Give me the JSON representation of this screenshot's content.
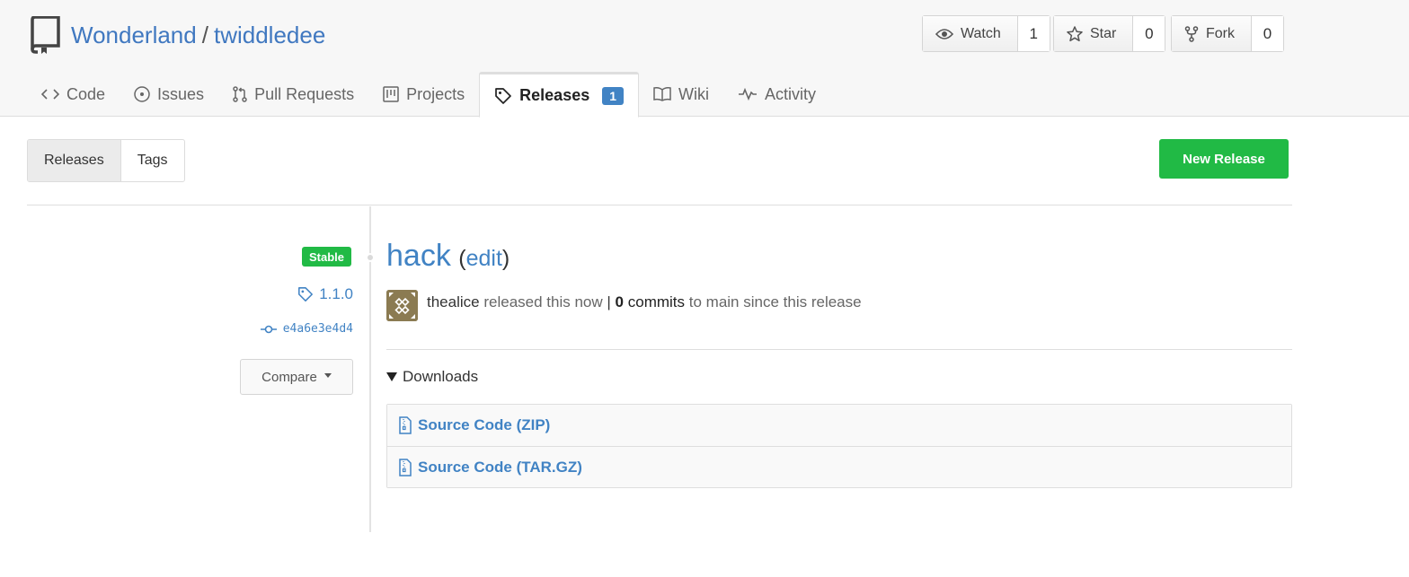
{
  "repo": {
    "owner": "Wonderland",
    "separator": "/",
    "name": "twiddledee",
    "icon": "repo-book-icon"
  },
  "header_buttons": {
    "watch": {
      "label": "Watch",
      "count": "1",
      "icon": "eye-icon"
    },
    "star": {
      "label": "Star",
      "count": "0",
      "icon": "star-icon"
    },
    "fork": {
      "label": "Fork",
      "count": "0",
      "icon": "fork-icon"
    }
  },
  "tabs": [
    {
      "label": "Code",
      "icon": "code-icon"
    },
    {
      "label": "Issues",
      "icon": "issue-icon"
    },
    {
      "label": "Pull Requests",
      "icon": "pull-request-icon"
    },
    {
      "label": "Projects",
      "icon": "project-icon"
    },
    {
      "label": "Releases",
      "icon": "tag-icon",
      "badge": "1",
      "active": true
    },
    {
      "label": "Wiki",
      "icon": "book-icon"
    },
    {
      "label": "Activity",
      "icon": "pulse-icon"
    }
  ],
  "subnav": {
    "releases": "Releases",
    "tags": "Tags"
  },
  "new_release_label": "New Release",
  "release": {
    "stable_label": "Stable",
    "tag": "1.1.0",
    "commit": "e4a6e3e4d4",
    "compare_label": "Compare",
    "title": "hack",
    "edit_open": "(",
    "edit_label": "edit",
    "edit_close": ")",
    "author": "thealice",
    "released_text": "released this now",
    "pipe": "|",
    "commit_count": "0",
    "commits_label": "commits",
    "since_text": "to main since this release",
    "downloads_label": "Downloads",
    "downloads": [
      {
        "label": "Source Code (ZIP)",
        "icon": "file-zip-icon"
      },
      {
        "label": "Source Code (TAR.GZ)",
        "icon": "file-zip-icon"
      }
    ]
  },
  "colors": {
    "accent": "#4183c4",
    "green": "#21ba45",
    "header_bg": "#f7f7f7"
  }
}
